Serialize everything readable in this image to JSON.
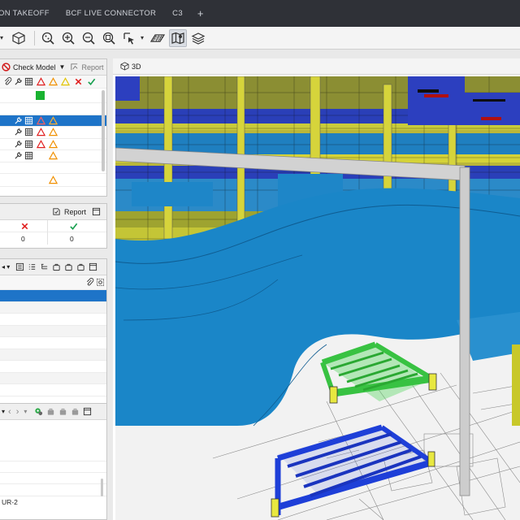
{
  "tabs": [
    {
      "label": "ON TAKEOFF"
    },
    {
      "label": "BCF LIVE CONNECTOR"
    },
    {
      "label": "C3"
    }
  ],
  "tab_plus": "+",
  "panel_check": {
    "check_model_label": "Check Model",
    "report_label": "Report"
  },
  "panel_summary": {
    "report_label": "Report",
    "error_count": "0",
    "ok_count": "0"
  },
  "viewport": {
    "tab_label": "3D"
  },
  "bottom_panel": {
    "label": "UR-2"
  },
  "colors": {
    "topbar": "#2f3137",
    "selection": "#1e74c8",
    "duct_blue": "#1a86c8",
    "frame_grey": "#cfcfcf",
    "cable_tray_green": "#3fd34a",
    "cable_tray_blue": "#1f3fd8",
    "steel_yellow": "#c8c82a"
  }
}
